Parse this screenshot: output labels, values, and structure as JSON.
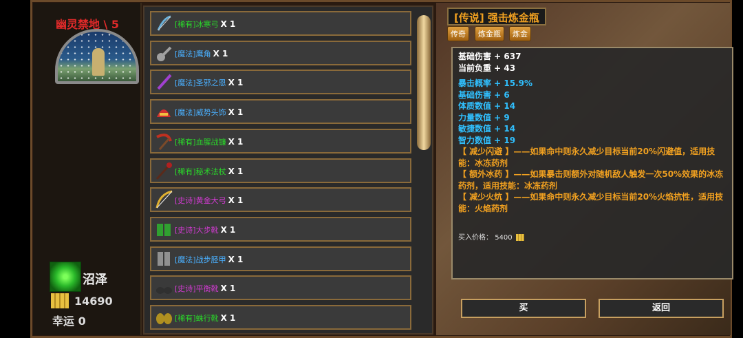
{
  "zone": {
    "title": "幽灵禁地 \\ 5"
  },
  "player": {
    "terrain": "沼泽",
    "gold": "14690",
    "luck": "幸运 0"
  },
  "items": [
    {
      "rarity": "[稀有]",
      "name": "冰寒弓",
      "qty": "X 1",
      "rarity_class": "c-rare",
      "name_class": "c-rare",
      "icon": "bow-icon",
      "icon_color": "#6ab0d8"
    },
    {
      "rarity": "[魔法]",
      "name": "鹰角",
      "qty": "X 1",
      "rarity_class": "c-magic",
      "name_class": "c-magic",
      "icon": "horn-icon",
      "icon_color": "#a0a0a0"
    },
    {
      "rarity": "[魔法]",
      "name": "圣邪之恩",
      "qty": "X 1",
      "rarity_class": "c-magic",
      "name_class": "c-magic",
      "icon": "dagger-icon",
      "icon_color": "#a040d0"
    },
    {
      "rarity": "[魔法]",
      "name": "威势头饰",
      "qty": "X 1",
      "rarity_class": "c-magic",
      "name_class": "c-magic",
      "icon": "helmet-icon",
      "icon_color": "#d03030"
    },
    {
      "rarity": "[稀有]",
      "name": "血腥战镰",
      "qty": "X 1",
      "rarity_class": "c-rare",
      "name_class": "c-rare",
      "icon": "scythe-icon",
      "icon_color": "#c03020"
    },
    {
      "rarity": "[稀有]",
      "name": "秘术法杖",
      "qty": "X 1",
      "rarity_class": "c-rare",
      "name_class": "c-rare",
      "icon": "staff-icon",
      "icon_color": "#b02020"
    },
    {
      "rarity": "[史诗]",
      "name": "黄金大弓",
      "qty": "X 1",
      "rarity_class": "c-epic",
      "name_class": "c-epic",
      "icon": "longbow-icon",
      "icon_color": "#e0b030"
    },
    {
      "rarity": "[史诗]",
      "name": "大步靴",
      "qty": "X 1",
      "rarity_class": "c-epic",
      "name_class": "c-epic",
      "icon": "boots-icon",
      "icon_color": "#30a030"
    },
    {
      "rarity": "[魔法]",
      "name": "战步胫甲",
      "qty": "X 1",
      "rarity_class": "c-magic",
      "name_class": "c-magic",
      "icon": "greaves-icon",
      "icon_color": "#909090"
    },
    {
      "rarity": "[史诗]",
      "name": "平衡靴",
      "qty": "X 1",
      "rarity_class": "c-epic",
      "name_class": "c-epic",
      "icon": "shoes-icon",
      "icon_color": "#303030"
    },
    {
      "rarity": "[稀有]",
      "name": "蛛行靴",
      "qty": "X 1",
      "rarity_class": "c-rare",
      "name_class": "c-rare",
      "icon": "spider-boots-icon",
      "icon_color": "#b09020"
    }
  ],
  "detail": {
    "title": "[传说] 强击炼金瓶",
    "tags": [
      "传奇",
      "炼金瓶",
      "炼金"
    ],
    "base": [
      "基础伤害 + 637",
      "当前负重 + 43"
    ],
    "stats": [
      "暴击概率 + 15.9%",
      "基础伤害 + 6",
      "体质数值 + 14",
      "力量数值 + 9",
      "敏捷数值 + 14",
      "智力数值 + 19"
    ],
    "effects": [
      "【 减少闪避 】——如果命中则永久减少目标当前20%闪避值，适用技能：冰冻药剂",
      "【 额外冰药 】——如果暴击则额外对随机敌人触发一次50%效果的冰冻药剂，适用技能：冰冻药剂",
      "【 减少火炕 】——如果命中则永久减少目标当前20%火焰抗性，适用技能：火焰药剂"
    ],
    "price_label": "买入价格：",
    "price": "5400"
  },
  "buttons": {
    "buy": "买",
    "back": "返回"
  },
  "colors": {
    "legendary": "#f0a020",
    "stat_blue": "#30c0ff",
    "rare": "#2ad82a",
    "magic": "#4ab0ff",
    "epic": "#d03ad0"
  }
}
